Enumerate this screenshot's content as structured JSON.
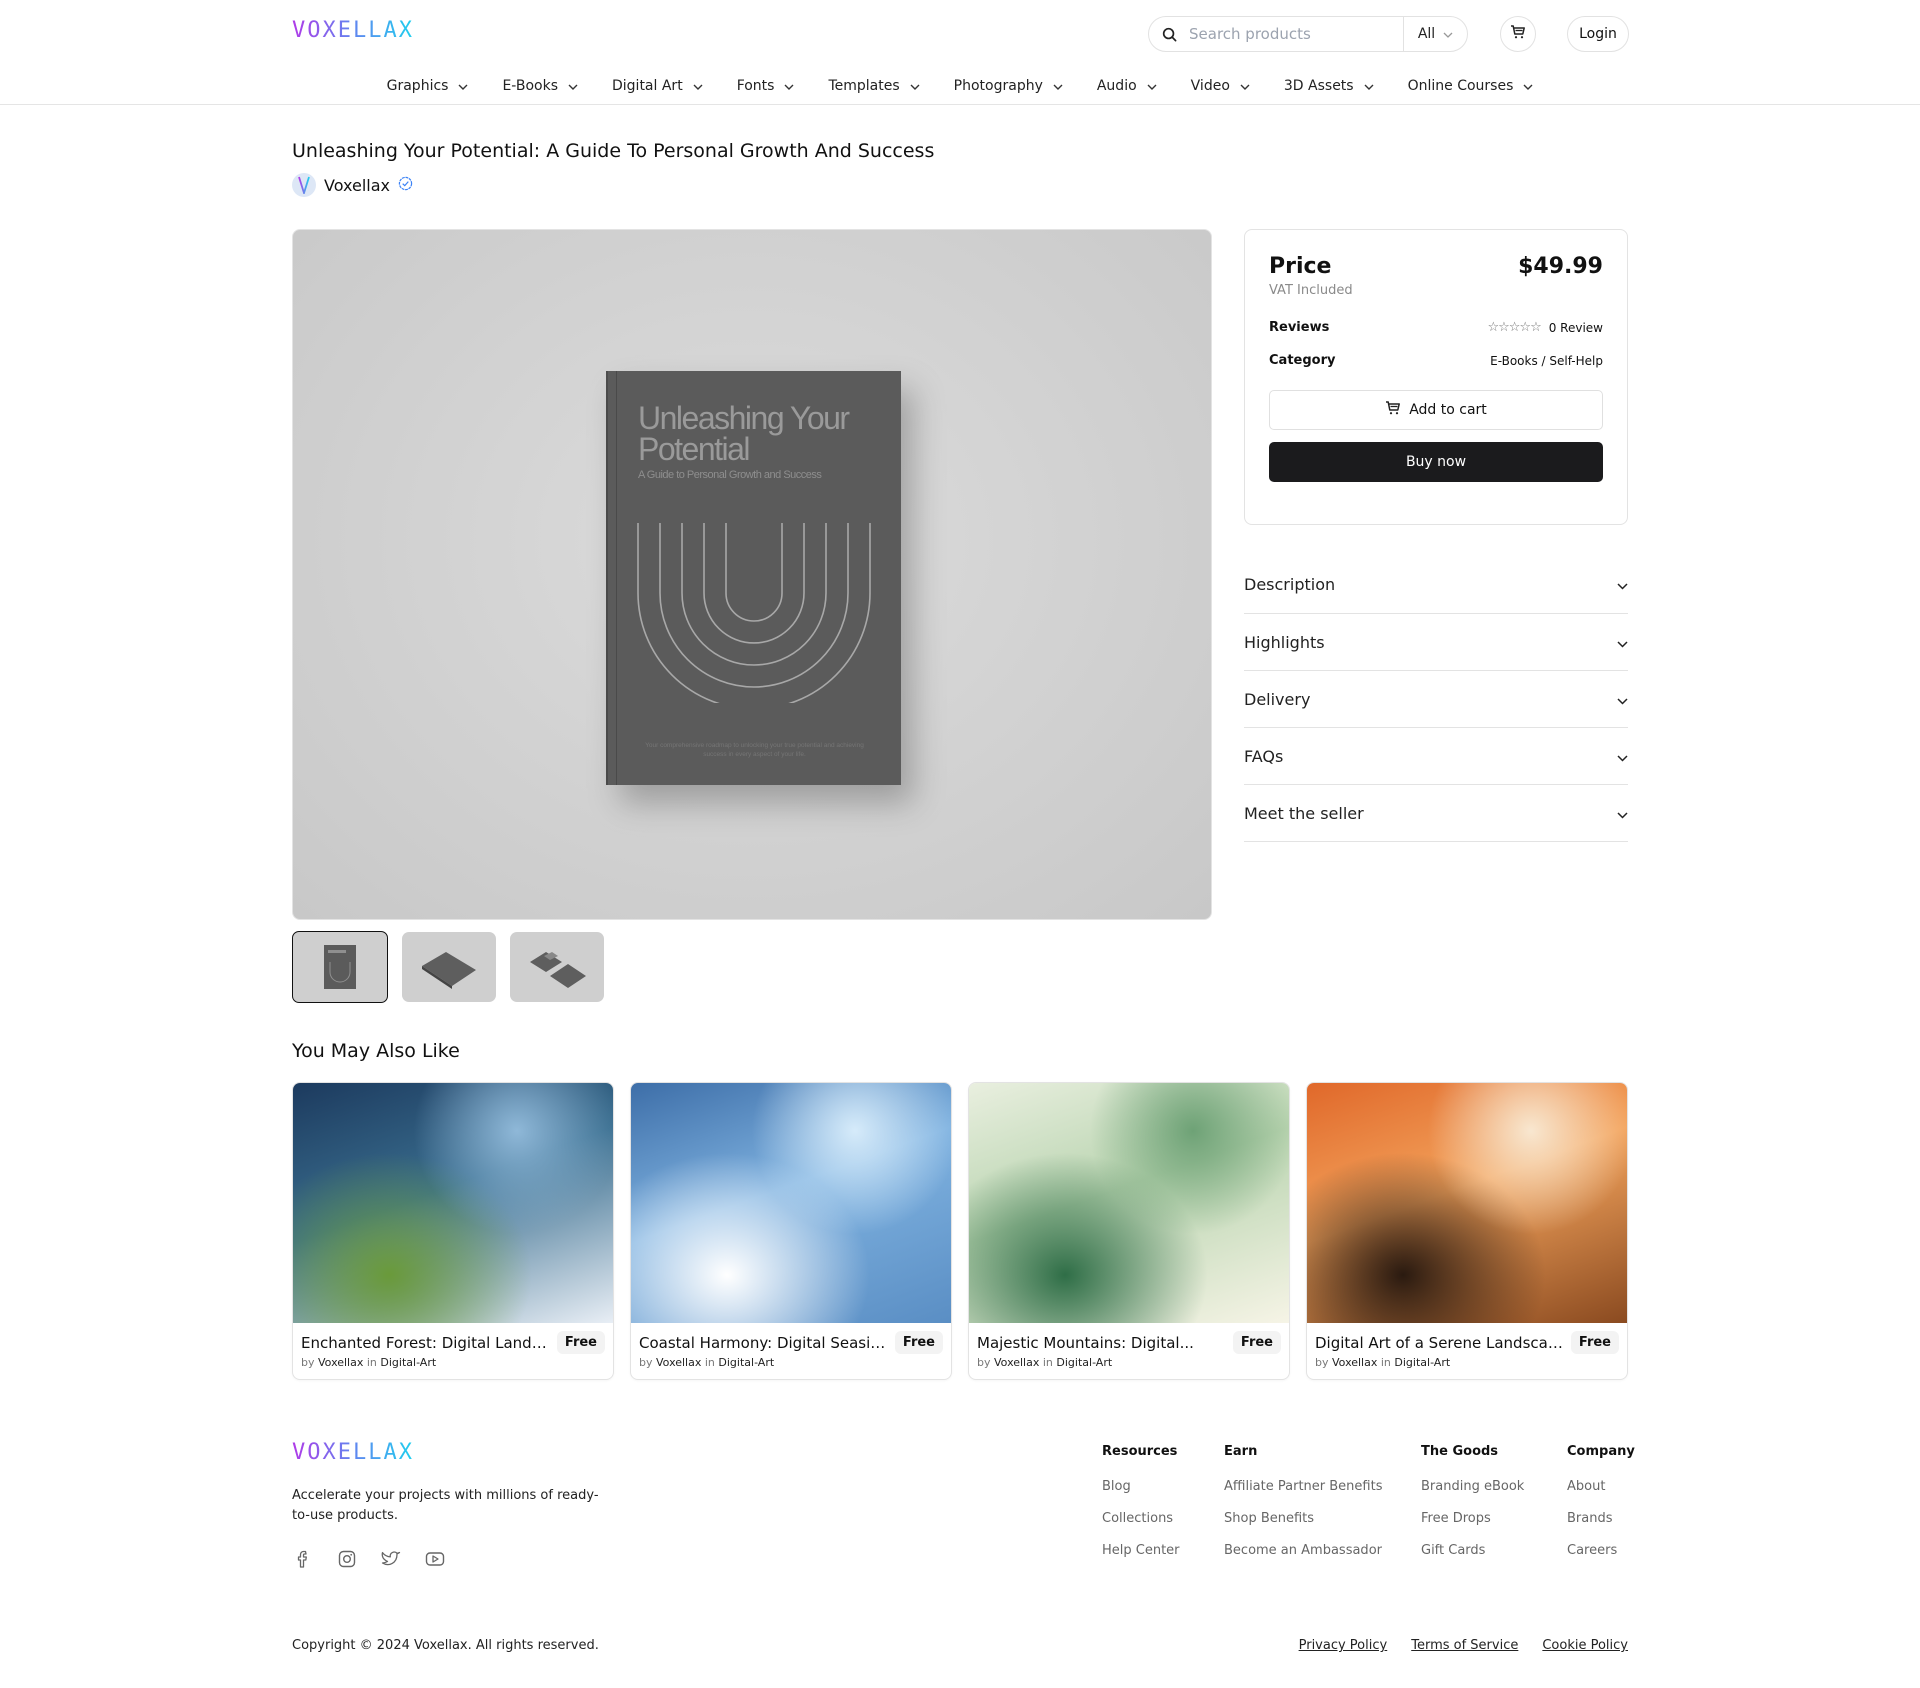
{
  "brand": {
    "logo_text": "VOXELLAX"
  },
  "header": {
    "search_placeholder": "Search products",
    "search_value": "",
    "category_selected": "All",
    "login_label": "Login"
  },
  "nav": {
    "items": [
      {
        "label": "Graphics"
      },
      {
        "label": "E-Books"
      },
      {
        "label": "Digital Art"
      },
      {
        "label": "Fonts"
      },
      {
        "label": "Templates"
      },
      {
        "label": "Photography"
      },
      {
        "label": "Audio"
      },
      {
        "label": "Video"
      },
      {
        "label": "3D Assets"
      },
      {
        "label": "Online Courses"
      }
    ]
  },
  "product": {
    "title": "Unleashing Your Potential: A Guide To Personal Growth And Success",
    "seller_name": "Voxellax",
    "seller_verified": true,
    "cover": {
      "title_line1": "Unleashing Your",
      "title_line2": "Potential",
      "subtitle": "A Guide to Personal Growth and Success",
      "footer_line1": "Your comprehensive roadmap to unlocking your true potential and achieving",
      "footer_line2": "success in every aspect of your life."
    },
    "thumbnails": [
      {
        "name": "front-view",
        "active": true
      },
      {
        "name": "angled-view",
        "active": false
      },
      {
        "name": "two-books-view",
        "active": false
      }
    ]
  },
  "price_card": {
    "price_label": "Price",
    "price": "$49.99",
    "vat_note": "VAT Included",
    "reviews_label": "Reviews",
    "rating": 0,
    "rating_max": 5,
    "reviews_count": "0 Review",
    "category_label": "Category",
    "category_value": "E-Books / Self-Help",
    "add_to_cart_label": "Add to cart",
    "buy_now_label": "Buy now"
  },
  "accordion": {
    "items": [
      {
        "label": "Description"
      },
      {
        "label": "Highlights"
      },
      {
        "label": "Delivery"
      },
      {
        "label": "FAQs"
      },
      {
        "label": "Meet the seller"
      }
    ]
  },
  "also_like": {
    "title": "You May Also Like",
    "cards": [
      {
        "name": "Enchanted Forest: Digital Landsca...",
        "price": "Free",
        "by": "by",
        "seller": "Voxellax",
        "in": "in",
        "category": "Digital-Art",
        "palette": [
          "#1c3a5e",
          "#3a6e8f",
          "#8fb8d8",
          "#6a9a3a",
          "#e8eef5"
        ]
      },
      {
        "name": "Coastal Harmony: Digital Seaside...",
        "price": "Free",
        "by": "by",
        "seller": "Voxellax",
        "in": "in",
        "category": "Digital-Art",
        "palette": [
          "#3d6ea8",
          "#7fb2e0",
          "#d6ebfa",
          "#ffffff",
          "#5a8ec4"
        ]
      },
      {
        "name": "Majestic Mountains: Digital...",
        "price": "Free",
        "by": "by",
        "seller": "Voxellax",
        "in": "in",
        "category": "Digital-Art",
        "palette": [
          "#e9efdf",
          "#b9d4b0",
          "#6ea276",
          "#2f6e47",
          "#f6f4e6"
        ]
      },
      {
        "name": "Digital Art of a Serene Landscape",
        "price": "Free",
        "by": "by",
        "seller": "Voxellax",
        "in": "in",
        "category": "Digital-Art",
        "palette": [
          "#e0682a",
          "#f3a35c",
          "#f8e7d0",
          "#2a1a10",
          "#8a4a20"
        ]
      }
    ]
  },
  "footer": {
    "logo_text": "VOXELLAX",
    "tagline": "Accelerate your projects with millions of ready-to-use products.",
    "socials": [
      "facebook",
      "instagram",
      "twitter",
      "youtube"
    ],
    "columns": [
      {
        "heading": "Resources",
        "links": [
          "Blog",
          "Collections",
          "Help Center"
        ]
      },
      {
        "heading": "Earn",
        "links": [
          "Affiliate Partner Benefits",
          "Shop Benefits",
          "Become an Ambassador"
        ]
      },
      {
        "heading": "The Goods",
        "links": [
          "Branding eBook",
          "Free Drops",
          "Gift Cards"
        ]
      },
      {
        "heading": "Company",
        "links": [
          "About",
          "Brands",
          "Careers"
        ]
      }
    ],
    "copyright": "Copyright © 2024 Voxellax. All rights reserved.",
    "legal_links": [
      "Privacy Policy",
      "Terms of Service",
      "Cookie Policy"
    ]
  }
}
